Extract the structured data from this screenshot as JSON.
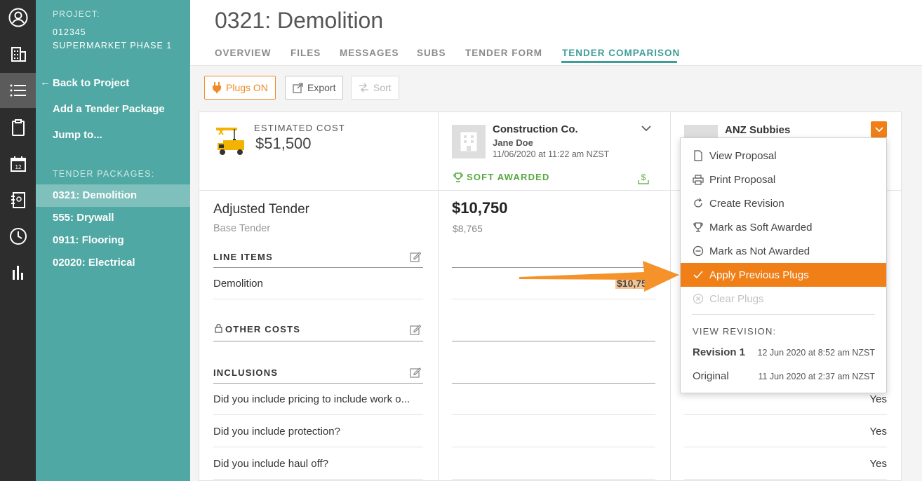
{
  "rail": {
    "items": [
      {
        "icon": "user-circle-icon"
      },
      {
        "icon": "building-icon"
      },
      {
        "icon": "list-icon",
        "active": true
      },
      {
        "icon": "clipboard-icon"
      },
      {
        "icon": "calendar-icon",
        "calendar_day": "12"
      },
      {
        "icon": "address-book-icon"
      },
      {
        "icon": "clock-icon"
      },
      {
        "icon": "bar-chart-icon"
      }
    ]
  },
  "sidebar": {
    "project_label": "PROJECT:",
    "project_number": "012345",
    "project_name": "SUPERMARKET PHASE 1",
    "back_arrow": "←",
    "back_link": "Back to Project",
    "add_package": "Add a Tender Package",
    "jump_to": "Jump to...",
    "packages_label": "TENDER PACKAGES:",
    "packages": [
      {
        "label": "0321: Demolition",
        "active": true
      },
      {
        "label": "555: Drywall"
      },
      {
        "label": "0911: Flooring"
      },
      {
        "label": "02020: Electrical"
      }
    ]
  },
  "header": {
    "title": "0321: Demolition",
    "tabs": [
      "OVERVIEW",
      "FILES",
      "MESSAGES",
      "SUBS",
      "TENDER FORM",
      "TENDER COMPARISON"
    ],
    "active_tab": "TENDER COMPARISON"
  },
  "toolbar": {
    "plugs_label": "Plugs ON",
    "export_label": "Export",
    "sort_label": "Sort"
  },
  "estimate": {
    "label": "ESTIMATED COST",
    "value": "$51,500"
  },
  "rows": {
    "adjusted_tender": "Adjusted Tender",
    "base_tender": "Base Tender",
    "line_items": "LINE ITEMS",
    "demolition": "Demolition",
    "other_costs": "OTHER COSTS",
    "inclusions": "INCLUSIONS",
    "questions": [
      "Did you include pricing to include work o...",
      "Did you include protection?",
      "Did you include haul off?"
    ]
  },
  "bidders": [
    {
      "name": "Construction Co.",
      "contact": "Jane Doe",
      "date": "11/06/2020 at 11:22 am NZST",
      "status": "SOFT AWARDED",
      "adjusted": "$10,750",
      "base": "$8,765",
      "plug_value": "$10,750"
    },
    {
      "name": "ANZ Subbies",
      "answers": [
        "Yes",
        "Yes",
        "Yes"
      ]
    }
  ],
  "menu": {
    "items": [
      {
        "label": "View Proposal",
        "icon": "document-icon"
      },
      {
        "label": "Print Proposal",
        "icon": "printer-icon"
      },
      {
        "label": "Create Revision",
        "icon": "refresh-icon"
      },
      {
        "label": "Mark as Soft Awarded",
        "icon": "trophy-icon"
      },
      {
        "label": "Mark as Not Awarded",
        "icon": "minus-circle-icon"
      },
      {
        "label": "Apply Previous Plugs",
        "icon": "check-icon",
        "highlighted": true
      },
      {
        "label": "Clear Plugs",
        "icon": "x-circle-icon",
        "disabled": true
      }
    ],
    "revision_label": "VIEW REVISION:",
    "revisions": [
      {
        "name": "Revision 1",
        "date": "12 Jun 2020 at 8:52 am NZST",
        "current": true
      },
      {
        "name": "Original",
        "date": "11 Jun 2020 at 2:37 am NZST"
      }
    ]
  },
  "colors": {
    "teal_sidebar": "#4fa8a3",
    "teal_active": "#3e9e99",
    "accent_orange": "#f07f18",
    "award_green": "#58a83f",
    "rail_dark": "#2d2d2d"
  }
}
